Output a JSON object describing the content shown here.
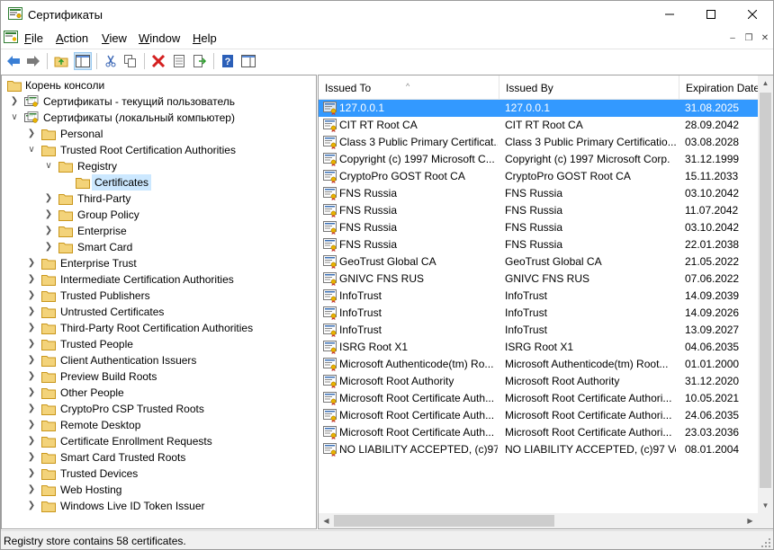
{
  "window": {
    "title": "Сертификаты",
    "app_icon": "certificate-mmc-icon"
  },
  "menu": {
    "items": [
      "File",
      "Action",
      "View",
      "Window",
      "Help"
    ],
    "mnemonics": [
      "F",
      "A",
      "V",
      "W",
      "H"
    ]
  },
  "toolbar": {
    "buttons": [
      "back-arrow-icon",
      "forward-arrow-icon",
      "up-folder-icon",
      "show-hide-console-tree-icon",
      "cut-icon",
      "copy-icon",
      "delete-icon",
      "properties-icon",
      "export-list-icon",
      "help-icon",
      "action-pane-icon"
    ]
  },
  "tree": {
    "root": "Корень консоли",
    "current_user": "Сертификаты - текущий пользователь",
    "local_computer": "Сертификаты (локальный компьютер)",
    "personal": "Personal",
    "trusted_root": "Trusted Root Certification Authorities",
    "registry": "Registry",
    "certificates": "Certificates",
    "third_party": "Third-Party",
    "group_policy": "Group Policy",
    "enterprise": "Enterprise",
    "smart_card": "Smart Card",
    "stores": [
      "Enterprise Trust",
      "Intermediate Certification Authorities",
      "Trusted Publishers",
      "Untrusted Certificates",
      "Third-Party Root Certification Authorities",
      "Trusted People",
      "Client Authentication Issuers",
      "Preview Build Roots",
      "Other People",
      "CryptoPro CSP Trusted Roots",
      "Remote Desktop",
      "Certificate Enrollment Requests",
      "Smart Card Trusted Roots",
      "Trusted Devices",
      "Web Hosting",
      "Windows Live ID Token Issuer"
    ]
  },
  "list": {
    "columns": [
      "Issued To",
      "Issued By",
      "Expiration Date"
    ],
    "sort_indicator": "^",
    "rows": [
      {
        "to": "127.0.0.1",
        "by": "127.0.0.1",
        "exp": "31.08.2025",
        "selected": true
      },
      {
        "to": "CIT RT Root CA",
        "by": "CIT RT Root CA",
        "exp": "28.09.2042"
      },
      {
        "to": "Class 3 Public Primary Certificat...",
        "by": "Class 3 Public Primary Certificatio...",
        "exp": "03.08.2028"
      },
      {
        "to": "Copyright (c) 1997 Microsoft C...",
        "by": "Copyright (c) 1997 Microsoft Corp.",
        "exp": "31.12.1999"
      },
      {
        "to": "CryptoPro GOST Root CA",
        "by": "CryptoPro GOST Root CA",
        "exp": "15.11.2033"
      },
      {
        "to": "FNS Russia",
        "by": "FNS Russia",
        "exp": "03.10.2042"
      },
      {
        "to": "FNS Russia",
        "by": "FNS Russia",
        "exp": "11.07.2042"
      },
      {
        "to": "FNS Russia",
        "by": "FNS Russia",
        "exp": "03.10.2042"
      },
      {
        "to": "FNS Russia",
        "by": "FNS Russia",
        "exp": "22.01.2038"
      },
      {
        "to": "GeoTrust Global CA",
        "by": "GeoTrust Global CA",
        "exp": "21.05.2022"
      },
      {
        "to": "GNIVC FNS RUS",
        "by": "GNIVC FNS RUS",
        "exp": "07.06.2022"
      },
      {
        "to": "InfoTrust",
        "by": "InfoTrust",
        "exp": "14.09.2039"
      },
      {
        "to": "InfoTrust",
        "by": "InfoTrust",
        "exp": "14.09.2026"
      },
      {
        "to": "InfoTrust",
        "by": "InfoTrust",
        "exp": "13.09.2027"
      },
      {
        "to": "ISRG Root X1",
        "by": "ISRG Root X1",
        "exp": "04.06.2035"
      },
      {
        "to": "Microsoft Authenticode(tm) Ro...",
        "by": "Microsoft Authenticode(tm) Root...",
        "exp": "01.01.2000"
      },
      {
        "to": "Microsoft Root Authority",
        "by": "Microsoft Root Authority",
        "exp": "31.12.2020"
      },
      {
        "to": "Microsoft Root Certificate Auth...",
        "by": "Microsoft Root Certificate Authori...",
        "exp": "10.05.2021"
      },
      {
        "to": "Microsoft Root Certificate Auth...",
        "by": "Microsoft Root Certificate Authori...",
        "exp": "24.06.2035"
      },
      {
        "to": "Microsoft Root Certificate Auth...",
        "by": "Microsoft Root Certificate Authori...",
        "exp": "23.03.2036"
      },
      {
        "to": "NO LIABILITY ACCEPTED, (c)97 ...",
        "by": "NO LIABILITY ACCEPTED, (c)97 Ve...",
        "exp": "08.01.2004"
      }
    ]
  },
  "status": {
    "text": "Registry store contains 58 certificates."
  },
  "colors": {
    "selection": "#3399ff",
    "tree_selection": "#cce8ff",
    "folder": "#f3d37a",
    "folder_dark": "#d9a520"
  }
}
